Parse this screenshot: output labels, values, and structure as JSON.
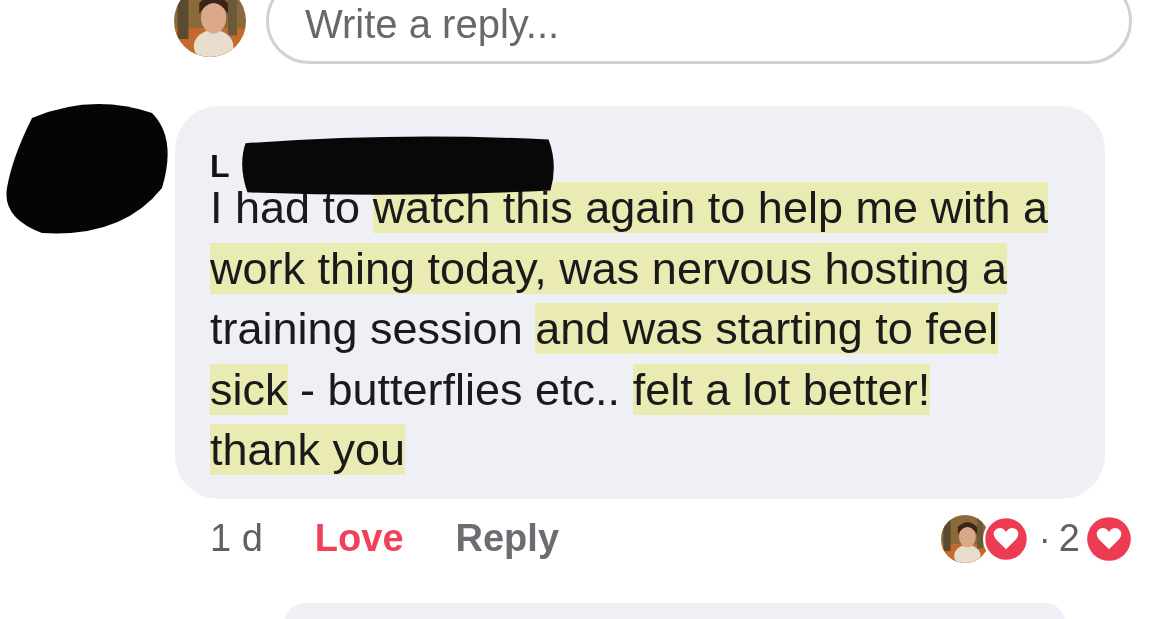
{
  "reply_box": {
    "placeholder": "Write a reply..."
  },
  "comment": {
    "author": "L",
    "author_redacted": true,
    "lines": [
      [
        {
          "text": "I had to ",
          "highlighted": false
        },
        {
          "text": "watch this again to help me with a",
          "highlighted": true
        }
      ],
      [
        {
          "text": "work thing today, was nervous hosting a",
          "highlighted": true
        }
      ],
      [
        {
          "text": "training session ",
          "highlighted": false
        },
        {
          "text": "and was starting to feel",
          "highlighted": true
        }
      ],
      [
        {
          "text": "sick",
          "highlighted": true
        },
        {
          "text": " - butterflies etc.. ",
          "highlighted": false
        },
        {
          "text": "felt a lot better!",
          "highlighted": true
        }
      ],
      [
        {
          "text": "thank you",
          "highlighted": true
        }
      ]
    ],
    "time": "1 d",
    "love": {
      "label": "Love",
      "selected": true
    },
    "reply": "Reply",
    "reactions": {
      "separator": "·",
      "count": "2"
    }
  }
}
